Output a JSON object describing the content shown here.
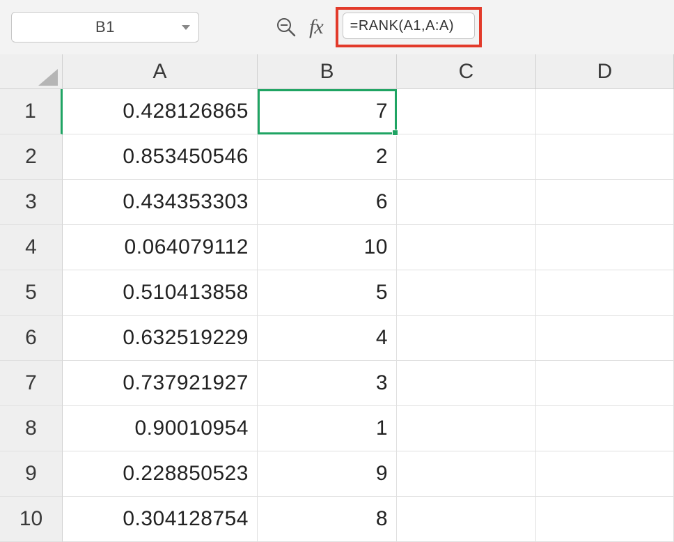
{
  "name_box": {
    "value": "B1"
  },
  "fx_label": "fx",
  "formula_bar": {
    "value": "=RANK(A1,A:A)"
  },
  "columns": [
    "A",
    "B",
    "C",
    "D"
  ],
  "row_numbers": [
    "1",
    "2",
    "3",
    "4",
    "5",
    "6",
    "7",
    "8",
    "9",
    "10"
  ],
  "cells": {
    "A": [
      "0.428126865",
      "0.853450546",
      "0.434353303",
      "0.064079112",
      "0.510413858",
      "0.632519229",
      "0.737921927",
      "0.90010954",
      "0.228850523",
      "0.304128754"
    ],
    "B": [
      "7",
      "2",
      "6",
      "10",
      "5",
      "4",
      "3",
      "1",
      "9",
      "8"
    ],
    "C": [
      "",
      "",
      "",
      "",
      "",
      "",
      "",
      "",
      "",
      ""
    ],
    "D": [
      "",
      "",
      "",
      "",
      "",
      "",
      "",
      "",
      "",
      ""
    ]
  },
  "active_cell": {
    "col": "B",
    "row": 1
  },
  "colors": {
    "selection": "#1fa463",
    "highlight_border": "#e23a2a"
  }
}
